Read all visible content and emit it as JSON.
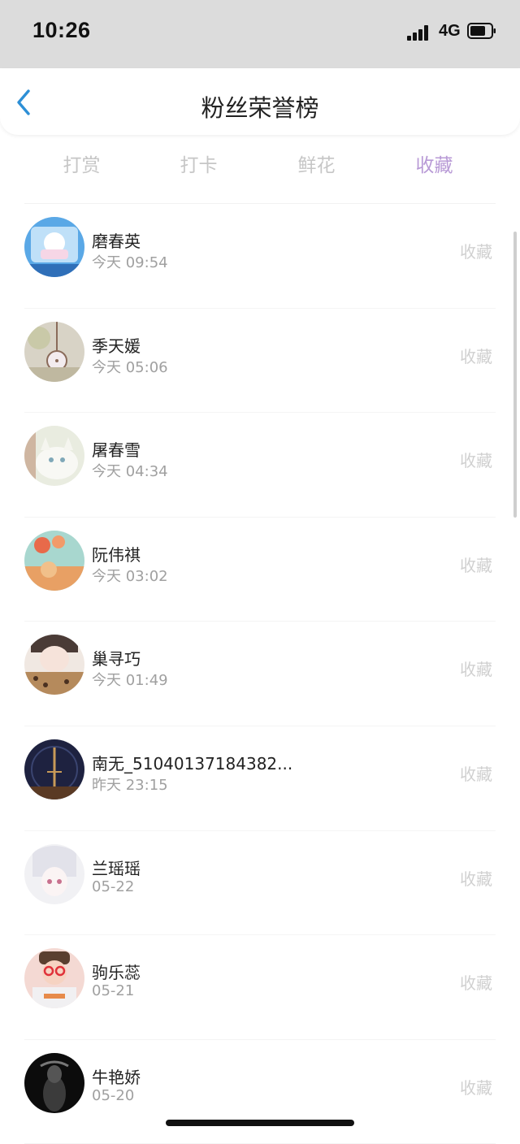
{
  "status_bar": {
    "time": "10:26",
    "network": "4G",
    "icons": [
      "signal-icon",
      "battery-icon"
    ]
  },
  "header": {
    "title": "粉丝荣誉榜",
    "back_icon": "chevron-left-icon"
  },
  "tabs": [
    {
      "label": "打赏",
      "active": false
    },
    {
      "label": "打卡",
      "active": false
    },
    {
      "label": "鲜花",
      "active": false
    },
    {
      "label": "收藏",
      "active": true
    }
  ],
  "colors": {
    "accent": "#b89ad6",
    "back_arrow": "#2d8fd6",
    "inactive_tab": "#c6c6c6",
    "action_text": "#d0d0d0"
  },
  "list": [
    {
      "name": "磨春英",
      "time": "今天 09:54",
      "action": "收藏"
    },
    {
      "name": "季天媛",
      "time": "今天 05:06",
      "action": "收藏"
    },
    {
      "name": "屠春雪",
      "time": "今天 04:34",
      "action": "收藏"
    },
    {
      "name": "阮伟祺",
      "time": "今天 03:02",
      "action": "收藏"
    },
    {
      "name": "巢寻巧",
      "time": "今天 01:49",
      "action": "收藏"
    },
    {
      "name": "南无_51040137184382...",
      "time": "昨天 23:15",
      "action": "收藏"
    },
    {
      "name": "兰瑶瑶",
      "time": "05-22",
      "action": "收藏"
    },
    {
      "name": "驹乐蕊",
      "time": "05-21",
      "action": "收藏"
    },
    {
      "name": "牛艳娇",
      "time": "05-20",
      "action": "收藏"
    }
  ]
}
